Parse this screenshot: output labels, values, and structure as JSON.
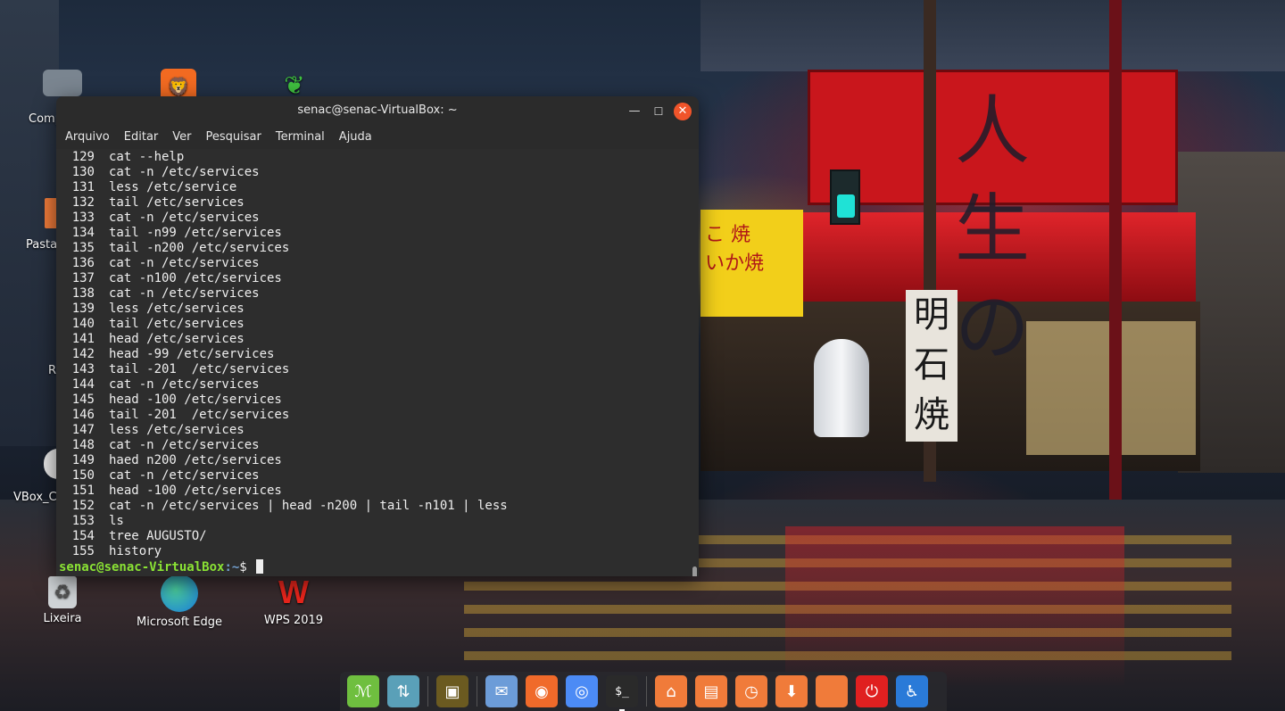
{
  "wallpaper": {
    "sign_main": "人生の",
    "sign_yellow": "こ 焼\nいか焼",
    "banner": "明石焼"
  },
  "desktop": {
    "partial_labels": [
      "Comp",
      "Pasta",
      "R",
      "VBox_C"
    ],
    "icons": [
      {
        "name": "trash",
        "label": "Lixeira",
        "icon": "recycle-icon"
      },
      {
        "name": "edge",
        "label": "Microsoft Edge",
        "icon": "edge-icon"
      },
      {
        "name": "wps",
        "label": "WPS 2019",
        "icon": "wps-icon"
      }
    ]
  },
  "terminal": {
    "title": "senac@senac-VirtualBox: ~",
    "menu": [
      "Arquivo",
      "Editar",
      "Ver",
      "Pesquisar",
      "Terminal",
      "Ajuda"
    ],
    "history": [
      {
        "n": "129",
        "cmd": "cat --help"
      },
      {
        "n": "130",
        "cmd": "cat -n /etc/services"
      },
      {
        "n": "131",
        "cmd": "less /etc/service"
      },
      {
        "n": "132",
        "cmd": "tail /etc/services"
      },
      {
        "n": "133",
        "cmd": "cat -n /etc/services"
      },
      {
        "n": "134",
        "cmd": "tail -n99 /etc/services"
      },
      {
        "n": "135",
        "cmd": "tail -n200 /etc/services"
      },
      {
        "n": "136",
        "cmd": "cat -n /etc/services"
      },
      {
        "n": "137",
        "cmd": "cat -n100 /etc/services"
      },
      {
        "n": "138",
        "cmd": "cat -n /etc/services"
      },
      {
        "n": "139",
        "cmd": "less /etc/services"
      },
      {
        "n": "140",
        "cmd": "tail /etc/services"
      },
      {
        "n": "141",
        "cmd": "head /etc/services"
      },
      {
        "n": "142",
        "cmd": "head -99 /etc/services"
      },
      {
        "n": "143",
        "cmd": "tail -201  /etc/services"
      },
      {
        "n": "144",
        "cmd": "cat -n /etc/services"
      },
      {
        "n": "145",
        "cmd": "head -100 /etc/services"
      },
      {
        "n": "146",
        "cmd": "tail -201  /etc/services"
      },
      {
        "n": "147",
        "cmd": "less /etc/services"
      },
      {
        "n": "148",
        "cmd": "cat -n /etc/services"
      },
      {
        "n": "149",
        "cmd": "haed n200 /etc/services"
      },
      {
        "n": "150",
        "cmd": "cat -n /etc/services"
      },
      {
        "n": "151",
        "cmd": "head -100 /etc/services"
      },
      {
        "n": "152",
        "cmd": "cat -n /etc/services | head -n200 | tail -n101 | less"
      },
      {
        "n": "153",
        "cmd": "ls"
      },
      {
        "n": "154",
        "cmd": "tree AUGUSTO/"
      },
      {
        "n": "155",
        "cmd": "history"
      }
    ],
    "prompt_user": "senac@senac-VirtualBox",
    "prompt_path": ":~",
    "prompt_symbol": "$ "
  },
  "dock": {
    "items": [
      {
        "name": "mint-menu",
        "icon": "mint-logo-icon",
        "color": "#6fbf3f"
      },
      {
        "name": "show-desktop",
        "icon": "windows-arrows-icon",
        "color": "#5aa0b8"
      },
      {
        "name": "image-viewer",
        "icon": "picture-icon",
        "color": "#6b5a20"
      },
      {
        "name": "mail",
        "icon": "envelope-icon",
        "color": "#6c9cd8"
      },
      {
        "name": "firefox",
        "icon": "firefox-icon",
        "color": "#f06a2a"
      },
      {
        "name": "chrome",
        "icon": "chrome-icon",
        "color": "#4c8bf5"
      },
      {
        "name": "terminal",
        "icon": "terminal-icon",
        "color": "#2a2a2a"
      },
      {
        "name": "home-folder",
        "icon": "folder-home-icon",
        "color": "#f07b3a"
      },
      {
        "name": "documents-folder",
        "icon": "folder-documents-icon",
        "color": "#f07b3a"
      },
      {
        "name": "recent-folder",
        "icon": "folder-recent-icon",
        "color": "#f07b3a"
      },
      {
        "name": "downloads-folder",
        "icon": "folder-downloads-icon",
        "color": "#f07b3a"
      },
      {
        "name": "files",
        "icon": "orange-square-icon",
        "color": "#f07b3a"
      },
      {
        "name": "shutdown",
        "icon": "power-icon",
        "color": "#e02020"
      },
      {
        "name": "accessibility",
        "icon": "accessibility-icon",
        "color": "#2a7ad8"
      }
    ]
  }
}
